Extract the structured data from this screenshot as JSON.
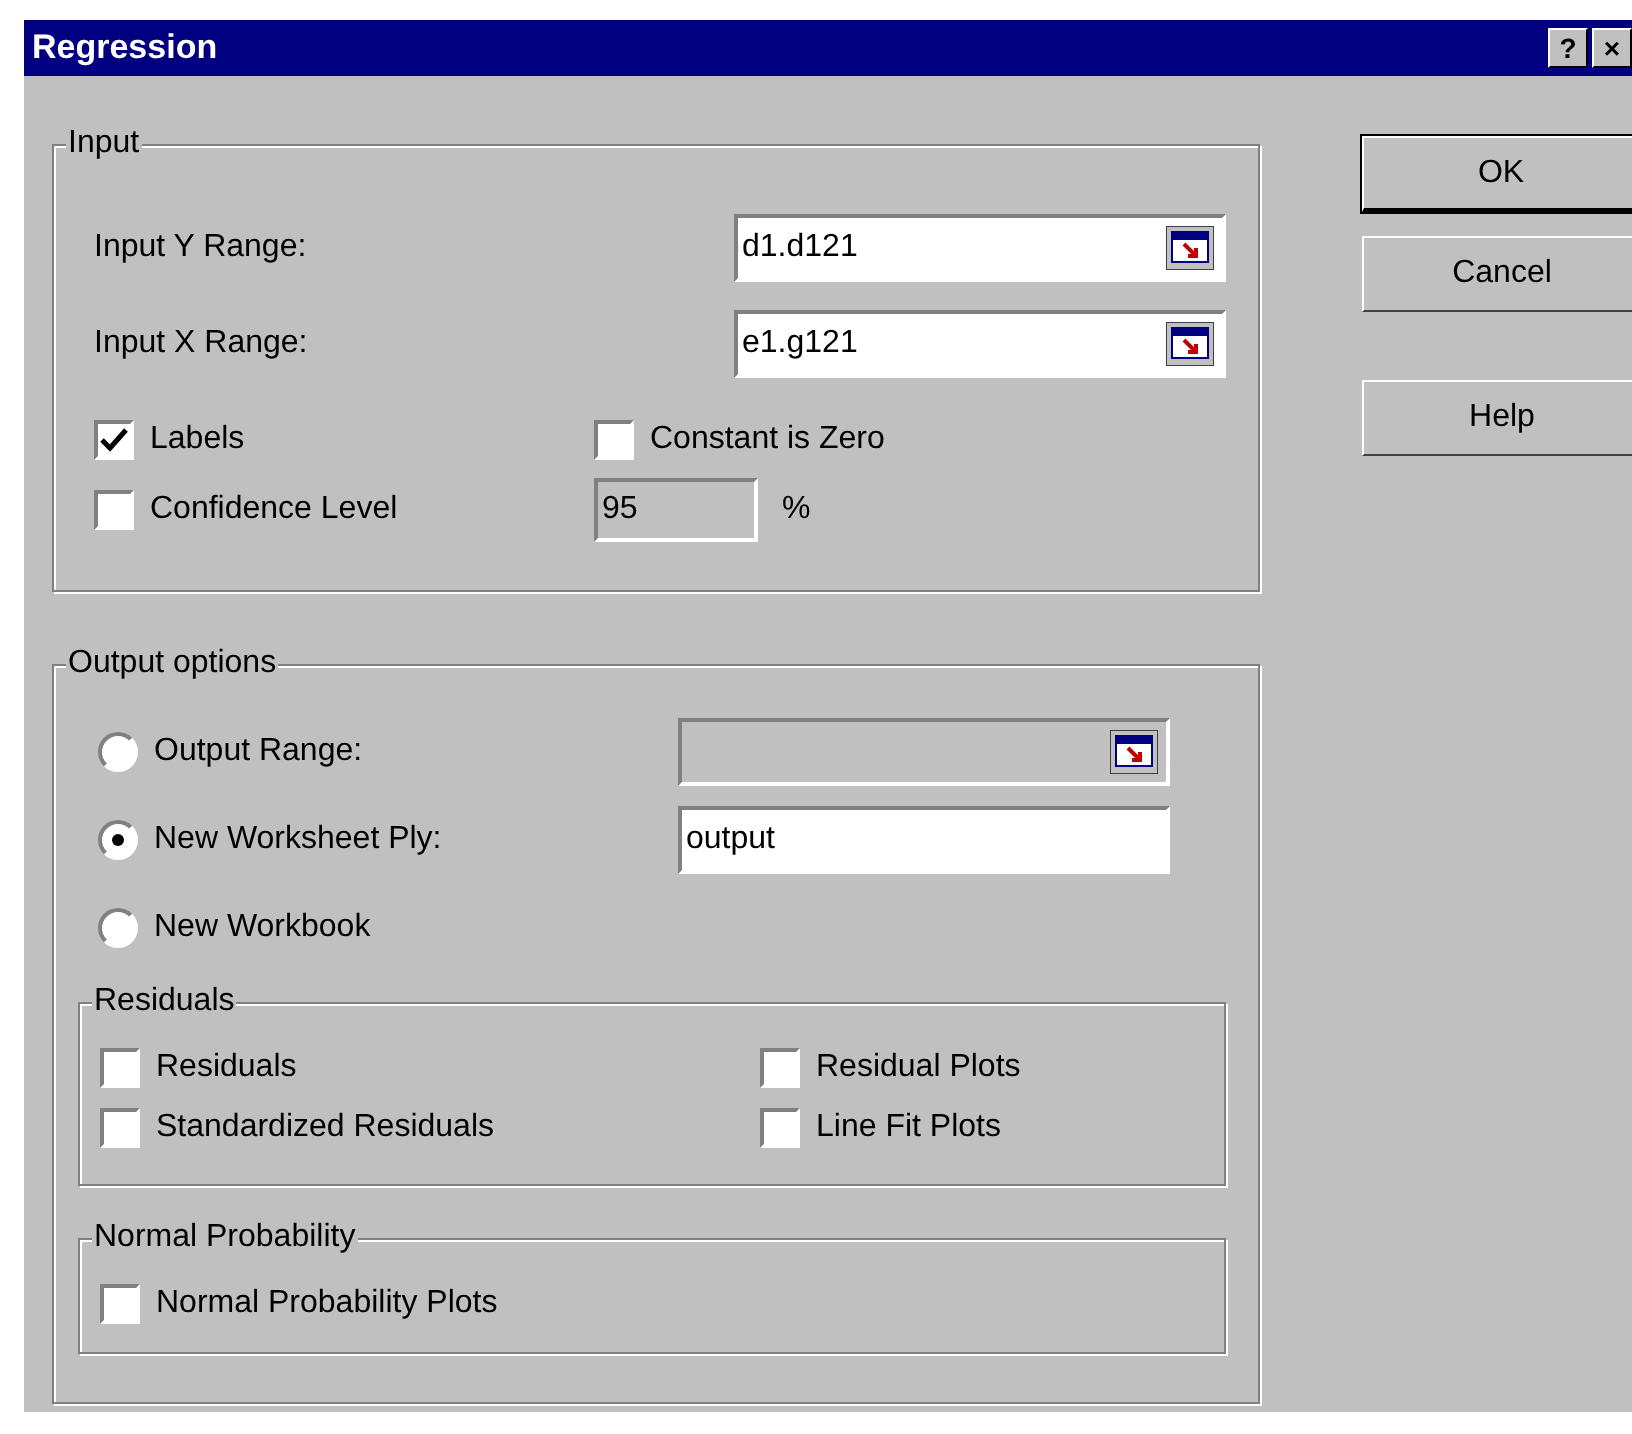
{
  "window": {
    "title": "Regression",
    "title_buttons": [
      "?",
      "×"
    ]
  },
  "input": {
    "title": "Input",
    "ranges": [
      {
        "label": "Input Y Range:",
        "value": "d1.d121"
      },
      {
        "label": "Input X Range:",
        "value": "e1.g121"
      }
    ],
    "labels": {
      "label": "Labels",
      "checked": true
    },
    "constant_is_zero": {
      "label": "Constant is Zero",
      "checked": false
    },
    "confidence": {
      "label": "Confidence Level",
      "checked": false,
      "value": "95",
      "unit": "%"
    }
  },
  "output_options": {
    "title": "Output options",
    "choices": [
      {
        "label": "Output Range:",
        "selected": false,
        "kind": "range"
      },
      {
        "label": "New Worksheet Ply:",
        "selected": true,
        "kind": "text",
        "value": "output"
      },
      {
        "label": "New Workbook",
        "selected": false,
        "kind": "none"
      }
    ],
    "residuals": {
      "title": "Residuals",
      "items": [
        {
          "label": "Residuals",
          "checked": false
        },
        {
          "label": "Residual Plots",
          "checked": false
        },
        {
          "label": "Standardized Residuals",
          "checked": false
        },
        {
          "label": "Line Fit Plots",
          "checked": false
        }
      ]
    },
    "normal_probability": {
      "title": "Normal Probability",
      "items": [
        {
          "label": "Normal Probability Plots",
          "checked": false
        }
      ]
    }
  },
  "buttons": [
    {
      "label": "OK",
      "default": true
    },
    {
      "label": "Cancel",
      "default": false
    },
    {
      "label": "Help",
      "default": false
    }
  ]
}
